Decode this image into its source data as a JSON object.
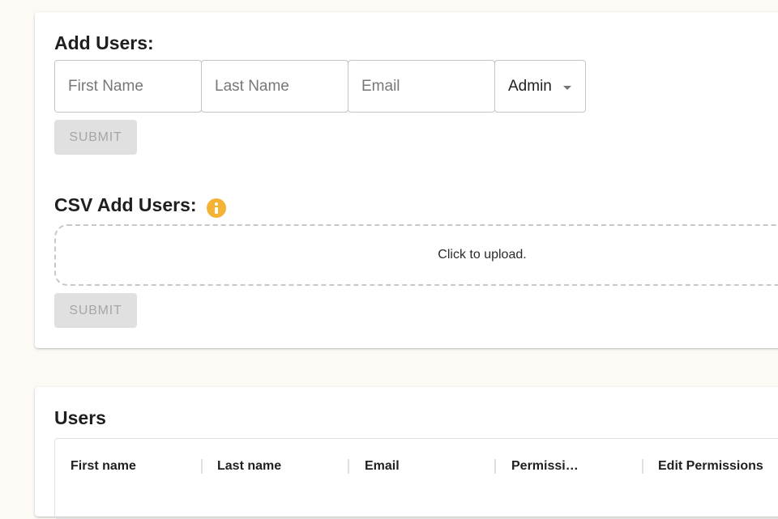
{
  "add_users": {
    "title": "Add Users:",
    "first_name_placeholder": "First Name",
    "last_name_placeholder": "Last Name",
    "email_placeholder": "Email",
    "role_value": "Admin",
    "submit_label": "SUBMIT"
  },
  "csv_add_users": {
    "title": "CSV Add Users:",
    "info_icon": "info-icon",
    "upload_text": "Click to upload.",
    "submit_label": "SUBMIT"
  },
  "users": {
    "title": "Users",
    "columns": [
      "First name",
      "Last name",
      "Email",
      "Permissi…",
      "Edit Permissions"
    ]
  },
  "colors": {
    "background": "#fdf9f5",
    "info_icon": "#f5b335",
    "disabled_button": "#e0e0e0",
    "disabled_text": "#a6a6a6"
  }
}
